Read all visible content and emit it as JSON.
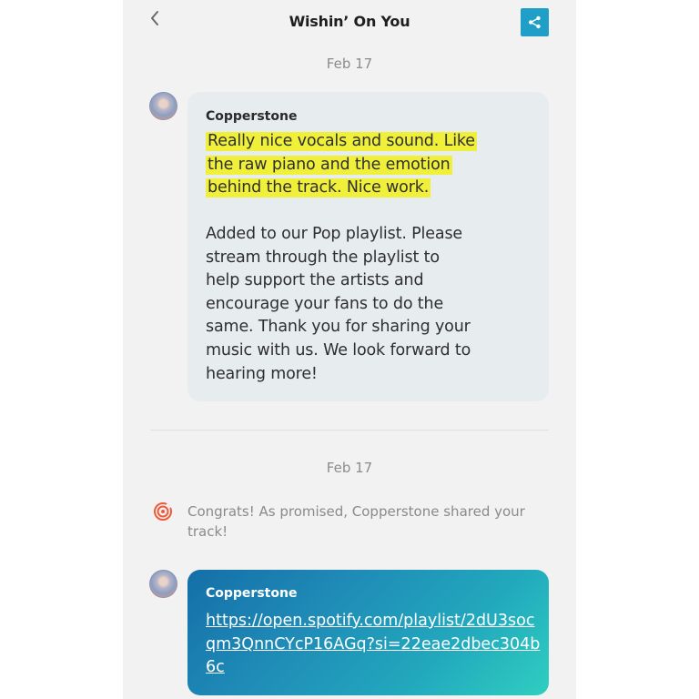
{
  "header": {
    "title": "Wishin’ On You",
    "back_icon": "chevron-left-icon",
    "share_icon": "share-icon",
    "share_color": "#1f9fc8"
  },
  "messages": [
    {
      "date": "Feb 17",
      "sender": "Copperstone",
      "highlighted_lines": [
        "Really nice vocals and sound.  Like",
        "the raw piano and the emotion",
        "behind the track.  Nice work."
      ],
      "body_lines": [
        "Added to our Pop playlist.  Please",
        "stream through the playlist to",
        "help support the artists and",
        "encourage your fans to do the",
        "same.  Thank you for sharing your",
        "music with us.  We look forward to",
        "hearing more!"
      ]
    },
    {
      "date": "Feb 17",
      "system_text": "Congrats! As promised, Copperstone shared your track!",
      "system_icon": "target-icon",
      "sender": "Copperstone",
      "link_text": "https://open.spotify.com/playlist/2dU3socqm3QnnCYcP16AGq?si=22eae2dbec304b6c"
    }
  ],
  "colors": {
    "highlight": "#f0f03a",
    "system_icon": "#f05a3c",
    "bubble_bg": "#e7ecee"
  }
}
